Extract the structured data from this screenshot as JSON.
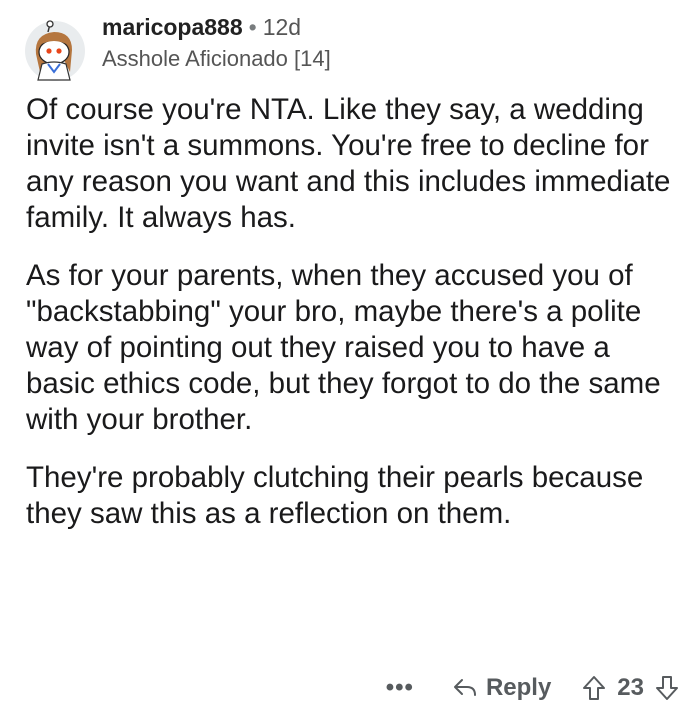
{
  "comment": {
    "username": "maricopa888",
    "separator": "•",
    "age": "12d",
    "flair": "Asshole Aficionado [14]",
    "paragraphs": [
      "Of course you're NTA.  Like they say, a wedding invite isn't a summons.  You're free to decline for any reason you want and this includes immediate family.  It always has.",
      "As for your parents, when they accused you of \"backstabbing\" your bro, maybe there's a polite way of  pointing out they raised you to have a basic ethics code, but they forgot to do the same with your brother.",
      "They're probably clutching their pearls because they saw this as a reflection on them."
    ]
  },
  "actions": {
    "more_label": "•••",
    "reply_label": "Reply",
    "vote_count": "23"
  },
  "icons": {
    "avatar": "user-avatar-icon",
    "reply": "reply-arrow-icon",
    "upvote": "upvote-arrow-icon",
    "downvote": "downvote-arrow-icon"
  }
}
